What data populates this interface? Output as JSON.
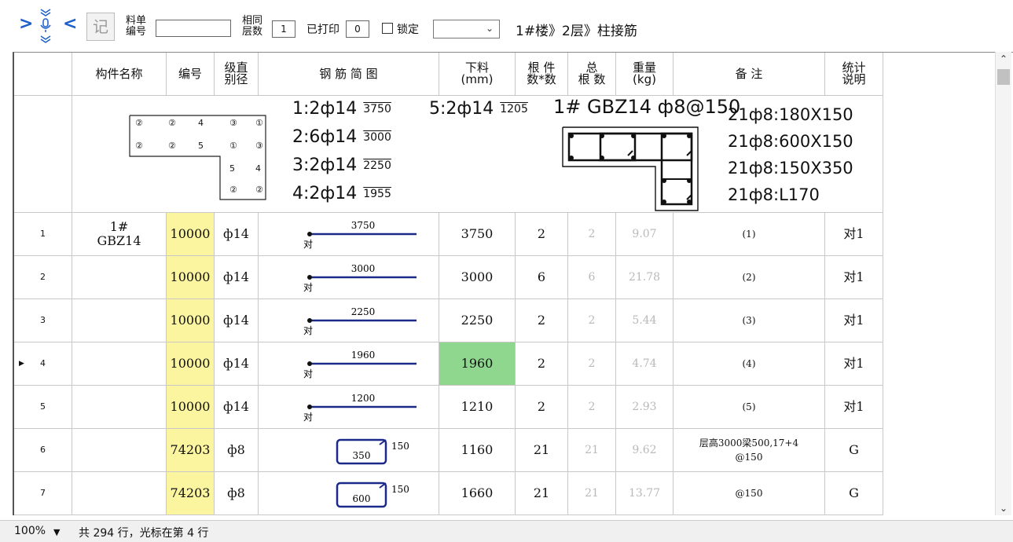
{
  "toolbar": {
    "rec_label": "记",
    "material_label_1": "料单",
    "material_label_2": "编号",
    "material_value": "",
    "same_floor_label_1": "相同",
    "same_floor_label_2": "层数",
    "same_floor_value": "1",
    "printed_label": "已打印",
    "printed_value": "0",
    "lock_label": "锁定",
    "select_value": "",
    "breadcrumb": "1#楼》2层》柱接筋"
  },
  "headers": [
    "",
    "构件名称",
    "编号",
    "级直\n别径",
    "钢 筋 简 图",
    "下料\n(mm)",
    "根 件\n数*数",
    "总\n根 数",
    "重量\n(kg)",
    "备      注",
    "统计\n说明"
  ],
  "drawing": {
    "title": "1# GBZ14 ф8@150",
    "bars": [
      {
        "spec": "1:2ф14",
        "len": "3750"
      },
      {
        "spec": "2:6ф14",
        "len": "3000"
      },
      {
        "spec": "3:2ф14",
        "len": "2250"
      },
      {
        "spec": "4:2ф14",
        "len": "1955"
      },
      {
        "spec": "5:2ф14",
        "len": "1205"
      }
    ],
    "stirrups": [
      "21ф8:180X150",
      "21ф8:600X150",
      "21ф8:150X350",
      "21ф8:L170"
    ],
    "marks_row1": [
      "②",
      "②",
      "4",
      "③",
      "①"
    ],
    "marks_row2": [
      "②",
      "②",
      "5",
      "①",
      "③"
    ],
    "marks_row3": [
      "5",
      "4"
    ],
    "marks_row4": [
      "②",
      "②"
    ]
  },
  "rows": [
    {
      "idx": "1",
      "name": "1#\nGBZ14",
      "code": "10000",
      "grade": "ф14",
      "shape_len": "3750",
      "shape_mark": "对",
      "cut": "3750",
      "count": "2",
      "total": "2",
      "weight": "9.07",
      "remark": "(1)",
      "stat": "对1"
    },
    {
      "idx": "2",
      "name": "",
      "code": "10000",
      "grade": "ф14",
      "shape_len": "3000",
      "shape_mark": "对",
      "cut": "3000",
      "count": "6",
      "total": "6",
      "weight": "21.78",
      "remark": "(2)",
      "stat": "对1"
    },
    {
      "idx": "3",
      "name": "",
      "code": "10000",
      "grade": "ф14",
      "shape_len": "2250",
      "shape_mark": "对",
      "cut": "2250",
      "count": "2",
      "total": "2",
      "weight": "5.44",
      "remark": "(3)",
      "stat": "对1"
    },
    {
      "idx": "4",
      "name": "",
      "code": "10000",
      "grade": "ф14",
      "shape_len": "1960",
      "shape_mark": "对",
      "cut": "1960",
      "count": "2",
      "total": "2",
      "weight": "4.74",
      "remark": "(4)",
      "stat": "对1",
      "current": true
    },
    {
      "idx": "5",
      "name": "",
      "code": "10000",
      "grade": "ф14",
      "shape_len": "1200",
      "shape_mark": "对",
      "cut": "1210",
      "count": "2",
      "total": "2",
      "weight": "2.93",
      "remark": "(5)",
      "stat": "对1"
    },
    {
      "idx": "6",
      "name": "",
      "code": "74203",
      "grade": "ф8",
      "shape_len": "350",
      "shape_side": "150",
      "cut": "1160",
      "count": "21",
      "total": "21",
      "weight": "9.62",
      "remark": "层高3000梁500,17+4\n@150",
      "stat": "G"
    },
    {
      "idx": "7",
      "name": "",
      "code": "74203",
      "grade": "ф8",
      "shape_len": "600",
      "shape_side": "150",
      "cut": "1660",
      "count": "21",
      "total": "21",
      "weight": "13.77",
      "remark": "@150",
      "stat": "G"
    }
  ],
  "status": {
    "zoom": "100%",
    "summary": "共 294 行，光标在第 4 行"
  },
  "colors": {
    "code_col_bg": "#fbf5a0",
    "current_cell_bg": "#8fd68f",
    "bar_line": "#1b2a8a",
    "nav_arrow": "#1d5fc9"
  }
}
